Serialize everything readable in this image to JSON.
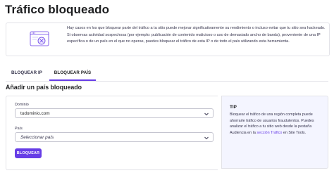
{
  "page": {
    "title": "Tráfico bloqueado"
  },
  "info": {
    "description": "Hay casos en los que bloquear parte del tráfico a tu sitio puede mejorar significativamente su rendimiento o incluso evitar que tu sitio sea hackeado. Si observas actividad sospechosa (por ejemplo: publicación de contenido malicioso o uso de demasiado ancho de banda), proveniente de una IP específica o de un país en el que no operas, puedes bloquear el tráfico de esta IP o de todo el país utilizando esta herramienta.",
    "illustration_icon": "blocked-window-icon"
  },
  "tabs": [
    {
      "label": "BLOQUEAR IP",
      "active": false
    },
    {
      "label": "BLOQUEAR PAÍS",
      "active": true
    }
  ],
  "form": {
    "section_title": "Añadir un país bloqueado",
    "domain_label": "Dominio",
    "domain_value": "tudominio.com",
    "country_label": "País",
    "country_placeholder": "Seleccionar país",
    "submit_label": "BLOQUEAR"
  },
  "tip": {
    "title": "TIP",
    "text_before_link": "Bloquear el tráfico de una región completa puede ahorrarle tráfico de usuarios fraudulentos. Puedes analizar el tráfico a tu sitio web desde la pestaña Audiencia en la ",
    "link_text": "sección Tráfico",
    "text_after_link": " en Site Tools."
  },
  "colors": {
    "accent": "#673de6",
    "tip_background": "#f4f5ff",
    "border": "#e3e3e8"
  }
}
